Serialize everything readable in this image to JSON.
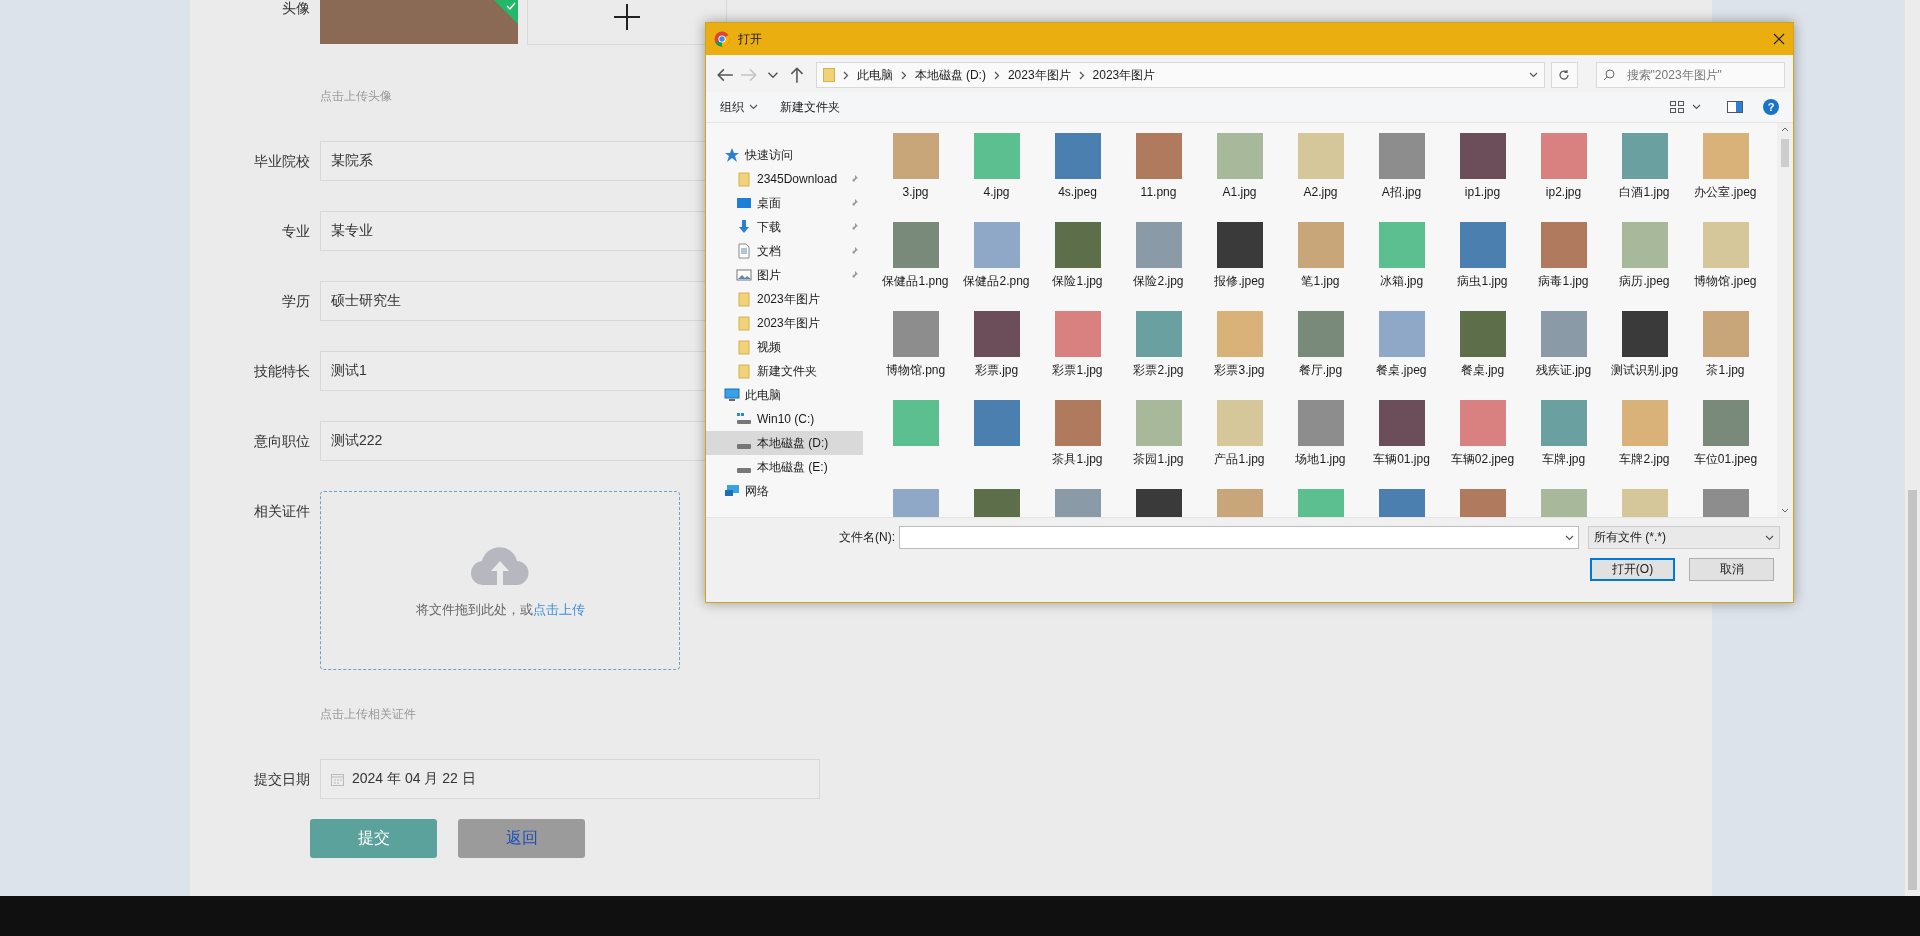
{
  "form": {
    "avatar": {
      "label": "头像",
      "uploaded": true,
      "hint": "点击上传头像"
    },
    "fields": [
      {
        "label": "毕业院校",
        "value": "某院系"
      },
      {
        "label": "专业",
        "value": "某专业"
      },
      {
        "label": "学历",
        "value": "硕士研究生"
      },
      {
        "label": "技能特长",
        "value": "测试1"
      },
      {
        "label": "意向职位",
        "value": "测试222"
      }
    ],
    "certificate": {
      "label": "相关证件",
      "drop_text": "将文件拖到此处，或",
      "drop_link": "点击上传",
      "hint": "点击上传相关证件"
    },
    "date": {
      "label": "提交日期",
      "value": "2024 年 04 月 22 日"
    },
    "buttons": [
      {
        "label": "提交",
        "kind": "primary"
      },
      {
        "label": "返回",
        "kind": "secondary"
      }
    ]
  },
  "dialog": {
    "title": "打开",
    "nav_buttons": [
      {
        "kind": "back",
        "disabled": false
      },
      {
        "kind": "forward",
        "disabled": true
      },
      {
        "kind": "recent",
        "disabled": false
      },
      {
        "kind": "up",
        "disabled": false
      }
    ],
    "breadcrumb": [
      "此电脑",
      "本地磁盘 (D:)",
      "2023年图片",
      "2023年图片"
    ],
    "search": {
      "placeholder": "搜索\"2023年图片\""
    },
    "toolbar": [
      {
        "label": "组织",
        "dropdown": true
      },
      {
        "label": "新建文件夹",
        "dropdown": false
      }
    ],
    "help": "?",
    "nav": [
      {
        "label": "快速访问",
        "kind": "star",
        "pinned": false,
        "selected": false,
        "children": [
          {
            "label": "2345Download",
            "kind": "folder",
            "pinned": true,
            "selected": false
          },
          {
            "label": "桌面",
            "kind": "desktop",
            "pinned": true,
            "selected": false
          },
          {
            "label": "下载",
            "kind": "download",
            "pinned": true,
            "selected": false
          },
          {
            "label": "文档",
            "kind": "document",
            "pinned": true,
            "selected": false
          },
          {
            "label": "图片",
            "kind": "pictures",
            "pinned": true,
            "selected": false
          },
          {
            "label": "2023年图片",
            "kind": "folder",
            "pinned": false,
            "selected": false
          },
          {
            "label": "2023年图片",
            "kind": "folder",
            "pinned": false,
            "selected": false
          },
          {
            "label": "视频",
            "kind": "folder",
            "pinned": false,
            "selected": false
          },
          {
            "label": "新建文件夹",
            "kind": "folder",
            "pinned": false,
            "selected": false
          }
        ]
      },
      {
        "label": "此电脑",
        "kind": "computer",
        "pinned": false,
        "selected": false,
        "children": [
          {
            "label": "Win10 (C:)",
            "kind": "system-drive",
            "pinned": false,
            "selected": false
          },
          {
            "label": "本地磁盘 (D:)",
            "kind": "drive",
            "pinned": false,
            "selected": true
          },
          {
            "label": "本地磁盘 (E:)",
            "kind": "drive",
            "pinned": false,
            "selected": false
          }
        ]
      },
      {
        "label": "网络",
        "kind": "network",
        "pinned": false,
        "selected": false
      }
    ],
    "files": [
      {
        "kind": "file",
        "name": "3.jpg"
      },
      {
        "kind": "file",
        "name": "4.jpg"
      },
      {
        "kind": "file",
        "name": "4s.jpeg"
      },
      {
        "kind": "file",
        "name": "11.png"
      },
      {
        "kind": "file",
        "name": "A1.jpg"
      },
      {
        "kind": "file",
        "name": "A2.jpg"
      },
      {
        "kind": "file",
        "name": "A招.jpg"
      },
      {
        "kind": "file",
        "name": "ip1.jpg"
      },
      {
        "kind": "file",
        "name": "ip2.jpg"
      },
      {
        "kind": "file",
        "name": "白酒1.jpg"
      },
      {
        "kind": "file",
        "name": "办公室.jpeg"
      },
      {
        "kind": "file",
        "name": "保健品1.png"
      },
      {
        "kind": "file",
        "name": "保健品2.png"
      },
      {
        "kind": "file",
        "name": "保险1.jpg"
      },
      {
        "kind": "file",
        "name": "保险2.jpg"
      },
      {
        "kind": "file",
        "name": "报修.jpeg"
      },
      {
        "kind": "file",
        "name": "笔1.jpg"
      },
      {
        "kind": "file",
        "name": "冰箱.jpg"
      },
      {
        "kind": "file",
        "name": "病虫1.jpg"
      },
      {
        "kind": "file",
        "name": "病毒1.jpg"
      },
      {
        "kind": "file",
        "name": "病历.jpeg"
      },
      {
        "kind": "file",
        "name": "博物馆.jpeg"
      },
      {
        "kind": "file",
        "name": "博物馆.png"
      },
      {
        "kind": "file",
        "name": "彩票.jpg"
      },
      {
        "kind": "file",
        "name": "彩票1.jpg"
      },
      {
        "kind": "file",
        "name": "彩票2.jpg"
      },
      {
        "kind": "file",
        "name": "彩票3.jpg"
      },
      {
        "kind": "file",
        "name": "餐厅.jpg"
      },
      {
        "kind": "file",
        "name": "餐桌.jpeg"
      },
      {
        "kind": "file",
        "name": "餐桌.jpg"
      },
      {
        "kind": "file",
        "name": "残疾证.jpg"
      },
      {
        "kind": "file",
        "name": "测试识别.jpg"
      },
      {
        "kind": "file",
        "name": "茶1.jpg"
      },
      {
        "kind": "thumbnail"
      },
      {
        "kind": "thumbnail"
      },
      {
        "kind": "file",
        "name": "茶具1.jpg"
      },
      {
        "kind": "file",
        "name": "茶园1.jpg"
      },
      {
        "kind": "file",
        "name": "产品1.jpg"
      },
      {
        "kind": "file",
        "name": "场地1.jpg"
      },
      {
        "kind": "file",
        "name": "车辆01.jpg"
      },
      {
        "kind": "file",
        "name": "车辆02.jpeg"
      },
      {
        "kind": "file",
        "name": "车牌.jpg"
      },
      {
        "kind": "file",
        "name": "车牌2.jpg"
      },
      {
        "kind": "file",
        "name": "车位01.jpeg"
      },
      {
        "kind": "thumbnail"
      },
      {
        "kind": "thumbnail"
      },
      {
        "kind": "thumbnail"
      },
      {
        "kind": "thumbnail"
      },
      {
        "kind": "thumbnail"
      },
      {
        "kind": "thumbnail"
      },
      {
        "kind": "thumbnail"
      },
      {
        "kind": "thumbnail"
      },
      {
        "kind": "thumbnail"
      },
      {
        "kind": "thumbnail"
      },
      {
        "kind": "thumbnail"
      }
    ],
    "filename_label": "文件名(N):",
    "filetype": "所有文件 (*.*)",
    "buttons": [
      {
        "label": "打开(O)",
        "kind": "default"
      },
      {
        "label": "取消",
        "kind": "normal"
      }
    ]
  }
}
